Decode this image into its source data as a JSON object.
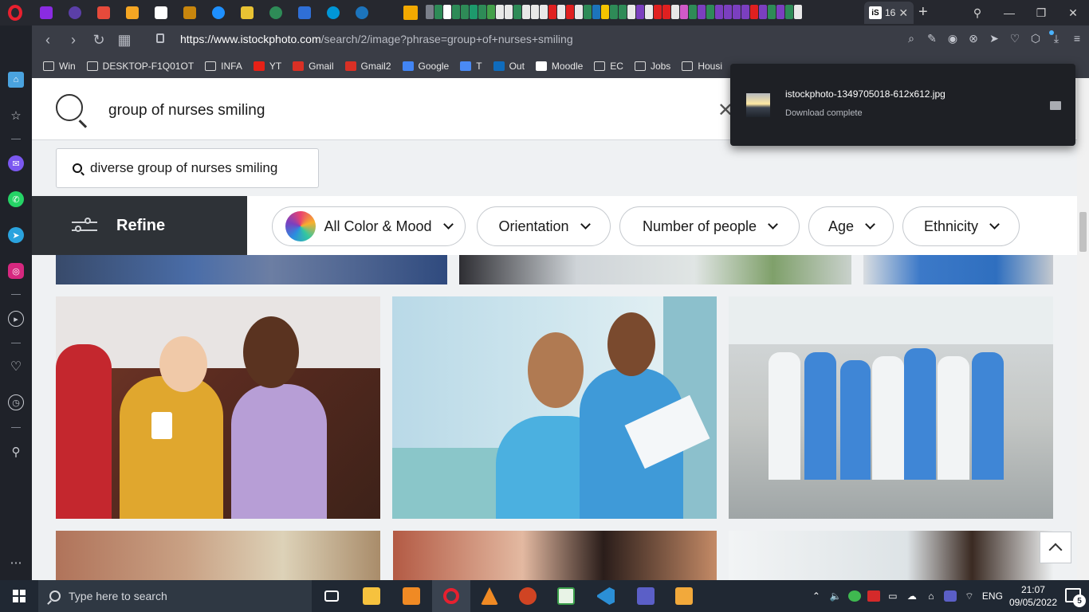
{
  "browser": {
    "active_tab_label": "16",
    "url_host": "https://www.istockphoto.com",
    "url_path": "/search/2/image?phrase=group+of+nurses+smiling",
    "bookmarks": [
      {
        "label": "Win",
        "icon": "folder-icon"
      },
      {
        "label": "DESKTOP-F1Q01OT",
        "icon": "folder-icon"
      },
      {
        "label": "INFA",
        "icon": "folder-icon"
      },
      {
        "label": "YT",
        "icon": "youtube-icon"
      },
      {
        "label": "Gmail",
        "icon": "gmail-icon"
      },
      {
        "label": "Gmail2",
        "icon": "gmail-icon"
      },
      {
        "label": "Google",
        "icon": "google-icon"
      },
      {
        "label": "T",
        "icon": "translate-icon"
      },
      {
        "label": "Out",
        "icon": "outlook-icon"
      },
      {
        "label": "Moodle",
        "icon": "moodle-icon"
      },
      {
        "label": "EC",
        "icon": "folder-icon"
      },
      {
        "label": "Jobs",
        "icon": "folder-icon"
      },
      {
        "label": "Housi",
        "icon": "folder-icon"
      }
    ]
  },
  "download": {
    "filename": "istockphoto-1349705018-612x612.jpg",
    "status": "Download complete"
  },
  "search": {
    "query": "group of nurses smiling",
    "suggestion": "diverse group of nurses smiling"
  },
  "refine": {
    "label": "Refine"
  },
  "filters": [
    {
      "label": "All Color & Mood"
    },
    {
      "label": "Orientation"
    },
    {
      "label": "Number of people"
    },
    {
      "label": "Age"
    },
    {
      "label": "Ethnicity"
    }
  ],
  "taskbar": {
    "search_placeholder": "Type here to search",
    "language": "ENG",
    "time": "21:07",
    "date": "09/05/2022",
    "notifications": "5"
  },
  "colors": {
    "refine_bg": "#2e3237",
    "page_bg": "#eff1f3",
    "browser_chrome": "#3a3d46",
    "taskbar_bg": "#202833"
  }
}
